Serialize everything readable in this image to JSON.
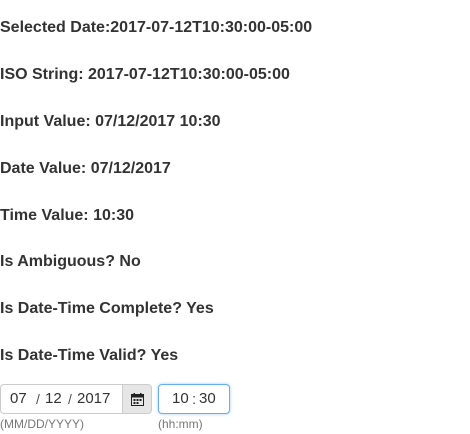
{
  "info": {
    "selected_date": {
      "label": "Selected Date:",
      "value": "2017-07-12T10:30:00-05:00"
    },
    "iso_string": {
      "label": "ISO String: ",
      "value": "2017-07-12T10:30:00-05:00"
    },
    "input_value": {
      "label": "Input Value: ",
      "value": "07/12/2017 10:30"
    },
    "date_value": {
      "label": "Date Value: ",
      "value": "07/12/2017"
    },
    "time_value": {
      "label": "Time Value: ",
      "value": "10:30"
    },
    "is_ambiguous": {
      "label": "Is Ambiguous? ",
      "value": "No"
    },
    "is_complete": {
      "label": "Is Date-Time Complete? ",
      "value": "Yes"
    },
    "is_valid": {
      "label": "Is Date-Time Valid? ",
      "value": "Yes"
    }
  },
  "date_picker": {
    "month": "07",
    "day": "12",
    "year": "2017",
    "separator": "/",
    "hint": "(MM/DD/YYYY)",
    "button_icon": "calendar-icon"
  },
  "time_picker": {
    "hours": "10",
    "minutes": "30",
    "separator": ":",
    "hint": "(hh:mm)"
  },
  "colors": {
    "text": "#333333",
    "hint": "#777777",
    "focus_border": "#66afe9",
    "button_bg": "#e6e6e6"
  }
}
